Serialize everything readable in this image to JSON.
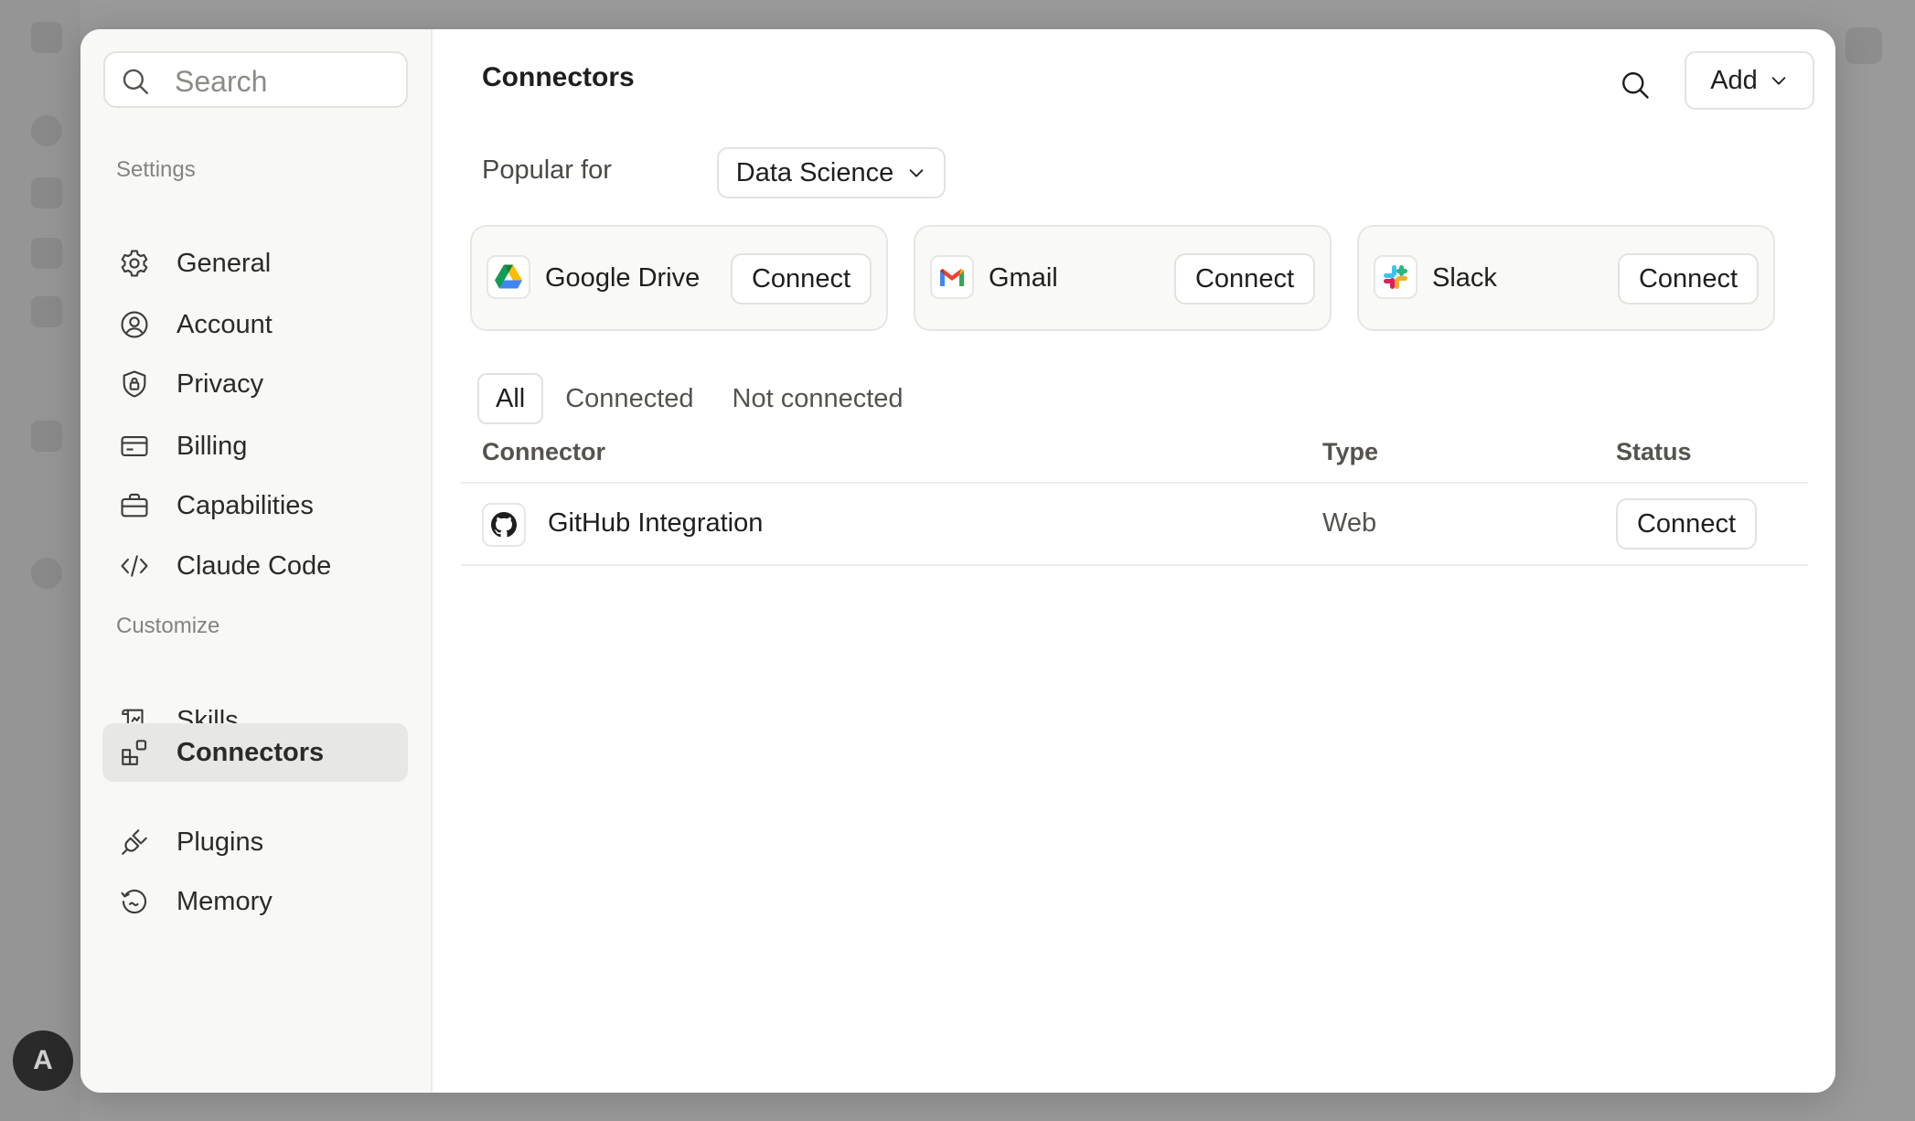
{
  "sidebar": {
    "search_placeholder": "Search",
    "settings_label": "Settings",
    "settings_items": [
      {
        "label": "General",
        "icon": "gear-icon"
      },
      {
        "label": "Account",
        "icon": "user-circle-icon"
      },
      {
        "label": "Privacy",
        "icon": "shield-lock-icon"
      },
      {
        "label": "Billing",
        "icon": "credit-card-icon"
      },
      {
        "label": "Capabilities",
        "icon": "briefcase-icon"
      },
      {
        "label": "Claude Code",
        "icon": "code-icon"
      }
    ],
    "customize_label": "Customize",
    "customize_items": [
      {
        "label": "Skills",
        "icon": "scroll-icon"
      },
      {
        "label": "Connectors",
        "icon": "connectors-icon",
        "active": true
      },
      {
        "label": "Plugins",
        "icon": "plug-icon"
      },
      {
        "label": "Memory",
        "icon": "memory-icon"
      }
    ]
  },
  "header": {
    "title": "Connectors",
    "add_label": "Add"
  },
  "popular": {
    "label": "Popular for",
    "selected": "Data Science",
    "cards": [
      {
        "name": "Google Drive",
        "button": "Connect",
        "icon": "google-drive-icon"
      },
      {
        "name": "Gmail",
        "button": "Connect",
        "icon": "gmail-icon"
      },
      {
        "name": "Slack",
        "button": "Connect",
        "icon": "slack-icon"
      }
    ]
  },
  "tabs": [
    "All",
    "Connected",
    "Not connected"
  ],
  "active_tab": "All",
  "table": {
    "columns": [
      "Connector",
      "Type",
      "Status"
    ],
    "rows": [
      {
        "name": "GitHub Integration",
        "type": "Web",
        "status_button": "Connect",
        "icon": "github-icon"
      }
    ]
  },
  "background": {
    "avatar_initial": "A"
  },
  "colors": {
    "overlay": "#9a9a9a",
    "sidebar_bg": "#f8f8f6",
    "active_item_bg": "#e7e7e4",
    "border": "#e2e2de"
  }
}
